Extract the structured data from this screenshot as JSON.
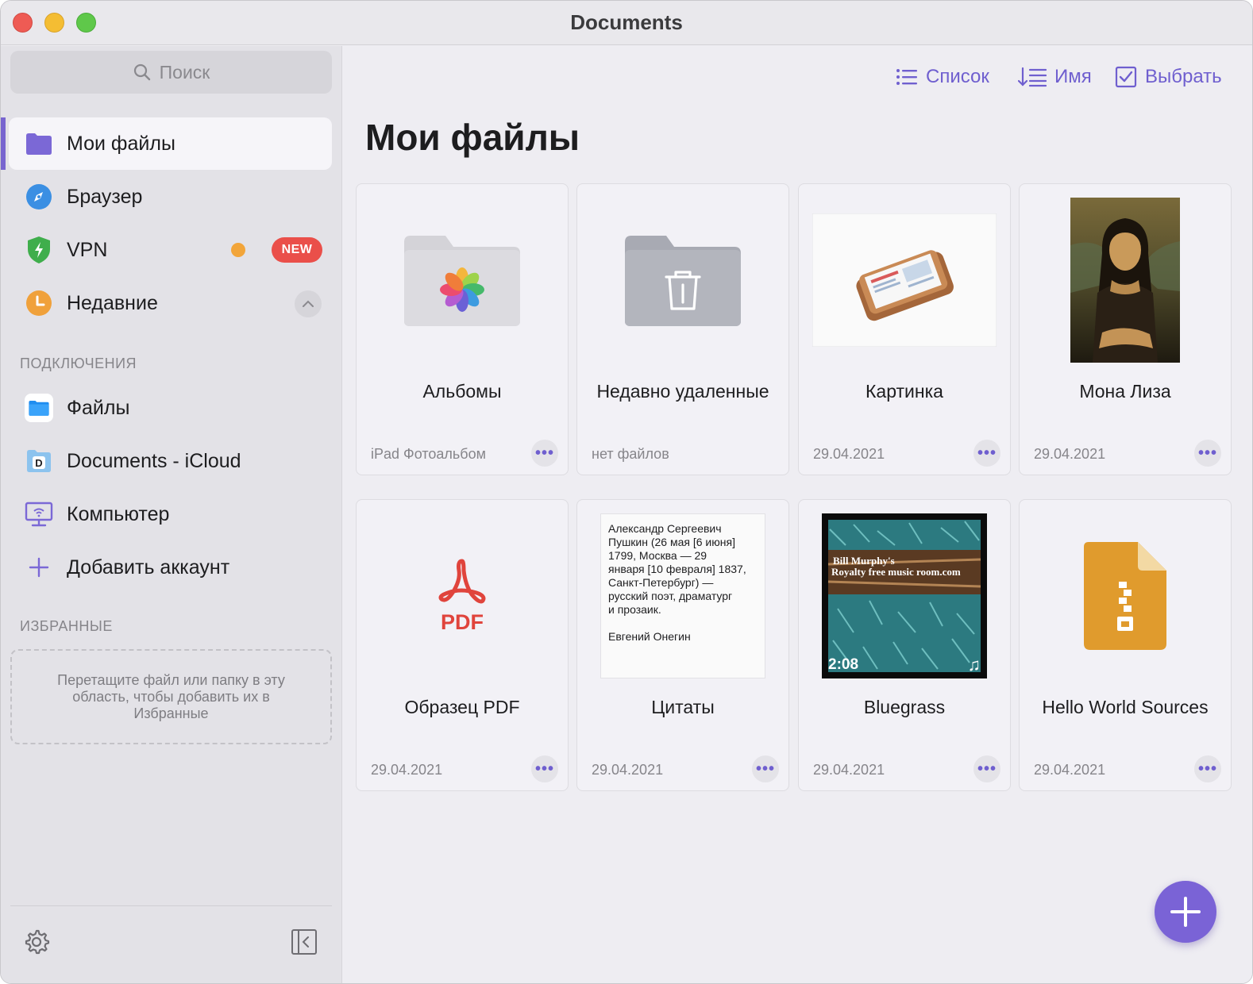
{
  "window": {
    "title": "Documents"
  },
  "sidebar": {
    "search_placeholder": "Поиск",
    "items": [
      {
        "label": "Мои файлы",
        "icon": "folder-icon"
      },
      {
        "label": "Браузер",
        "icon": "compass-icon"
      },
      {
        "label": "VPN",
        "icon": "shield-icon",
        "badge": "NEW"
      },
      {
        "label": "Недавние",
        "icon": "clock-icon"
      }
    ],
    "connections_title": "ПОДКЛЮЧЕНИЯ",
    "connections": [
      {
        "label": "Файлы",
        "icon": "files-app-icon"
      },
      {
        "label": "Documents - iCloud",
        "icon": "documents-icloud-icon"
      },
      {
        "label": "Компьютер",
        "icon": "computer-icon"
      },
      {
        "label": "Добавить аккаунт",
        "icon": "plus-icon"
      }
    ],
    "favorites_title": "ИЗБРАННЫЕ",
    "favorites_hint": "Перетащите файл или папку в эту область, чтобы добавить их в Избранные"
  },
  "toolbar": {
    "list_label": "Список",
    "sort_label": "Имя",
    "select_label": "Выбрать"
  },
  "main": {
    "title": "Мои файлы",
    "items": [
      {
        "title": "Альбомы",
        "meta": "iPad Фотоальбом",
        "kind": "photos-folder",
        "has_more": true
      },
      {
        "title": "Недавно удаленные",
        "meta": "нет файлов",
        "kind": "trash-folder",
        "has_more": false
      },
      {
        "title": "Картинка",
        "meta": "29.04.2021",
        "kind": "image",
        "has_more": true
      },
      {
        "title": "Мона Лиза",
        "meta": "29.04.2021",
        "kind": "painting",
        "has_more": true
      },
      {
        "title": "Образец PDF",
        "meta": "29.04.2021",
        "kind": "pdf",
        "has_more": true
      },
      {
        "title": "Цитаты",
        "meta": "29.04.2021",
        "kind": "text",
        "has_more": true
      },
      {
        "title": "Bluegrass",
        "meta": "29.04.2021",
        "kind": "audio",
        "has_more": true
      },
      {
        "title": "Hello World Sources",
        "meta": "29.04.2021",
        "kind": "zip",
        "has_more": true
      }
    ],
    "pdf_label": "PDF",
    "quote_text": "Александр Сергеевич\nПушкин (26 мая [6 июня]\n1799, Москва — 29\nянваря [10 февраля] 1837,\nСанкт-Петербург) —\nрусский поэт, драматург\nи прозаик.\n\nЕвгений Онегин",
    "music_banner_line1": "Bill Murphy's",
    "music_banner_line2": "Royalty free music room.com",
    "music_duration": "2:08",
    "more_label": "•••"
  },
  "colors": {
    "accent": "#6f5fcf",
    "badge_red": "#ea4f4a",
    "vpn_dot": "#f2a53a",
    "fab": "#7a63d6"
  }
}
